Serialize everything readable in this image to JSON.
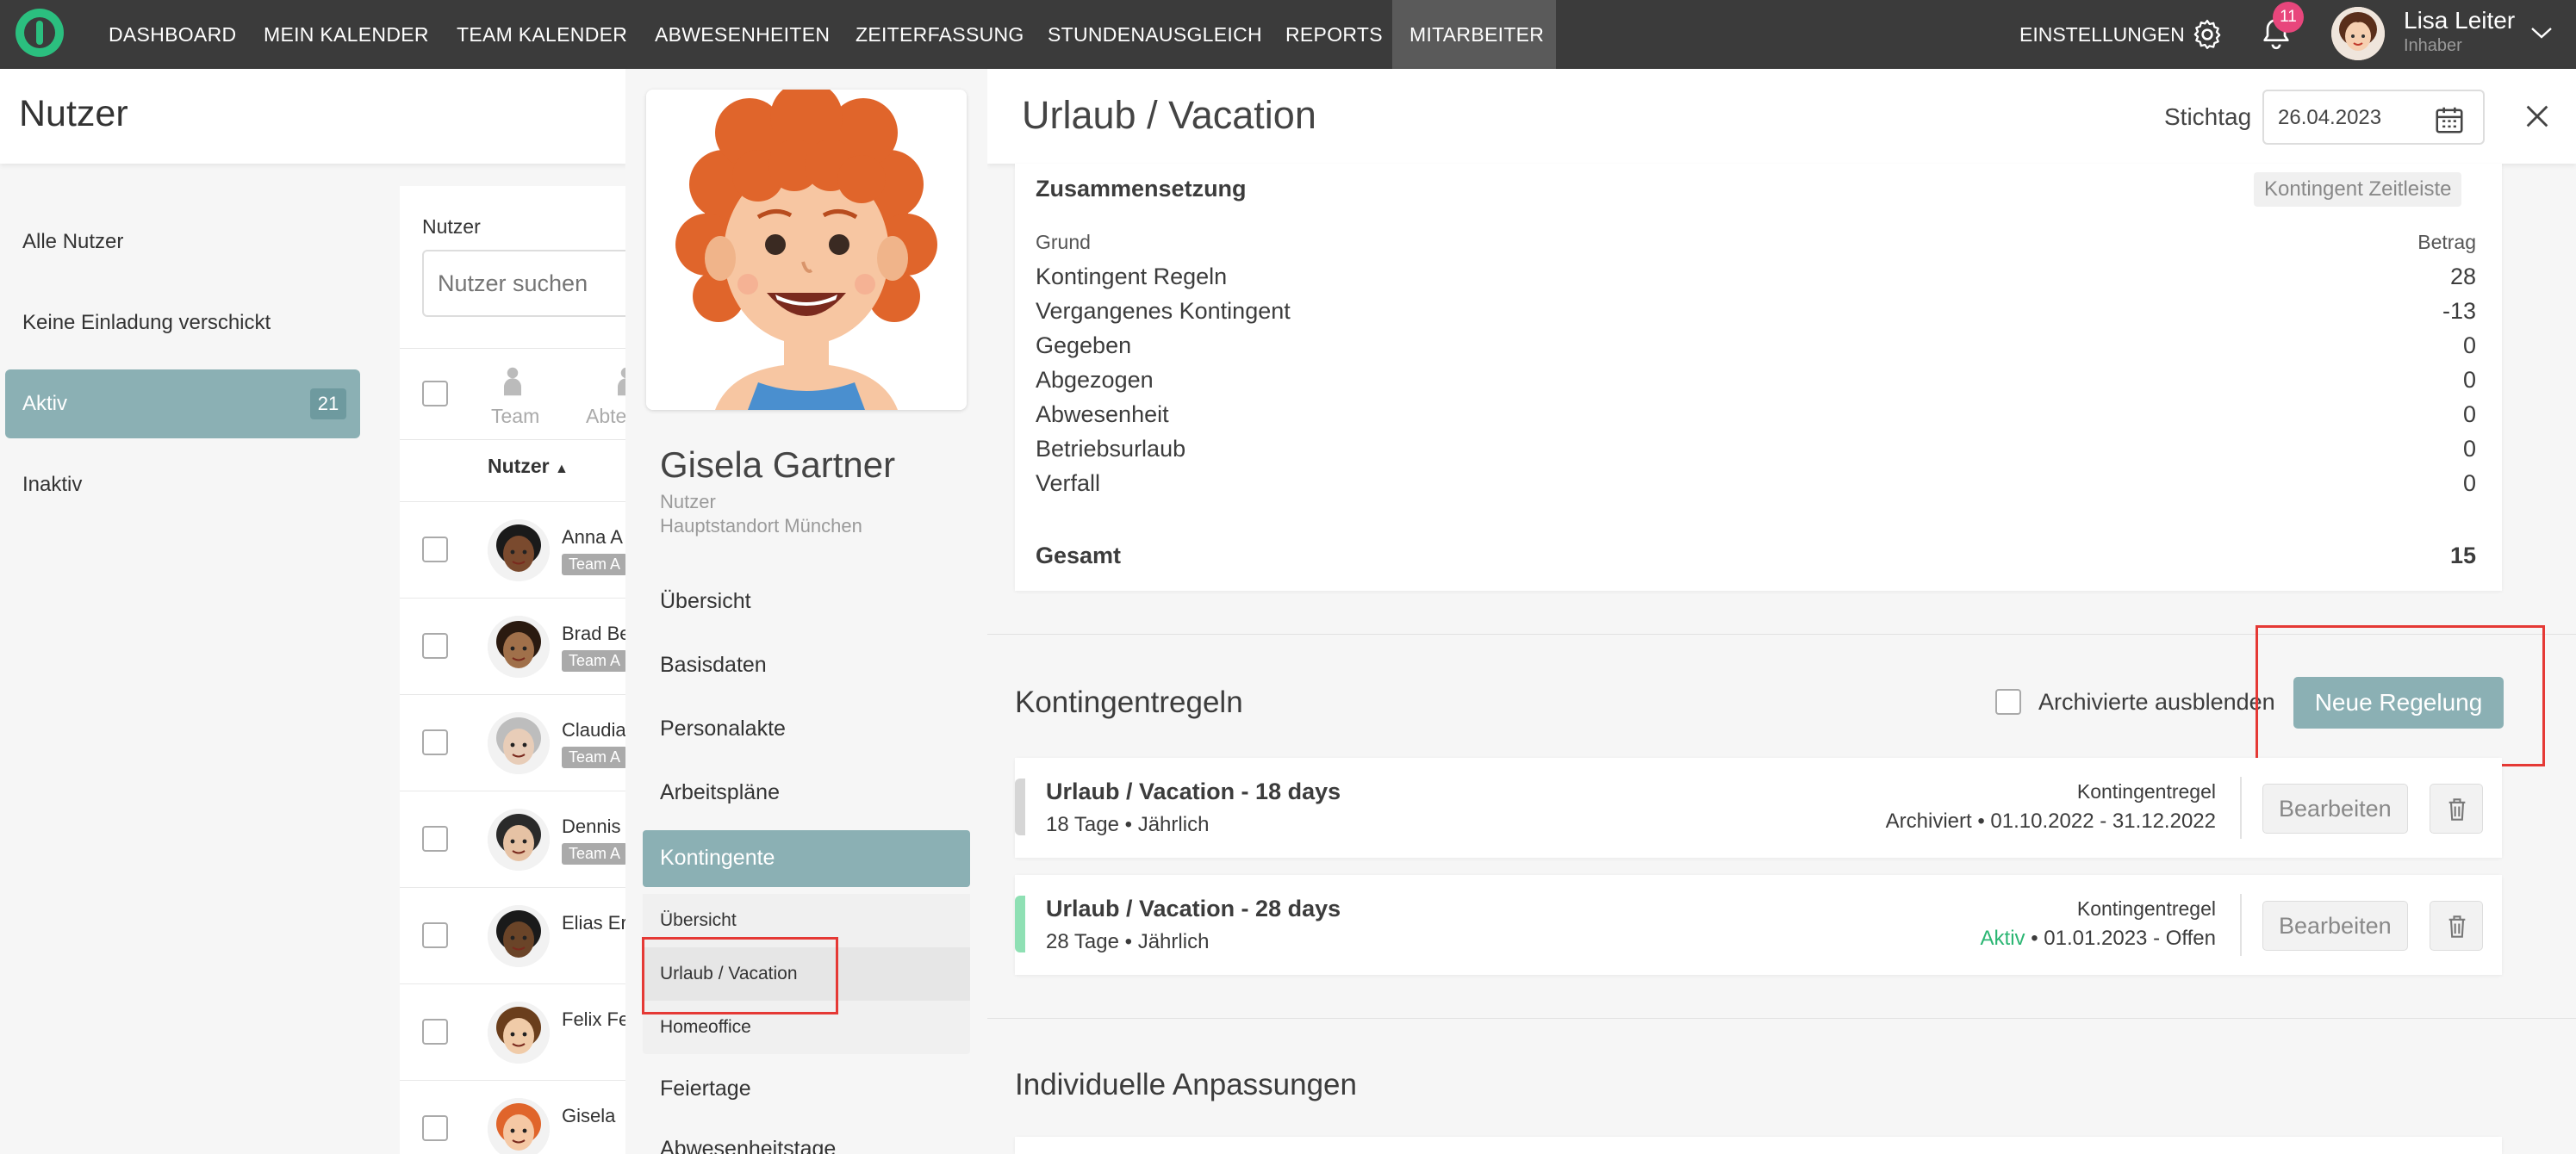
{
  "topbar": {
    "nav": [
      "DASHBOARD",
      "MEIN KALENDER",
      "TEAM KALENDER",
      "ABWESENHEITEN",
      "ZEITERFASSUNG",
      "STUNDENAUSGLEICH",
      "REPORTS",
      "MITARBEITER"
    ],
    "settings_label": "EINSTELLUNGEN",
    "notification_count": "11",
    "user_name": "Lisa Leiter",
    "user_role": "Inhaber"
  },
  "left": {
    "title": "Nutzer",
    "items": [
      {
        "label": "Alle Nutzer"
      },
      {
        "label": "Keine Einladung verschickt"
      },
      {
        "label": "Aktiv",
        "count": "21"
      },
      {
        "label": "Inaktiv"
      }
    ]
  },
  "userlist": {
    "search_label": "Nutzer",
    "search_placeholder": "Nutzer suchen",
    "filter_team": "Team",
    "filter_abt": "Abte",
    "col_header": "Nutzer",
    "users": [
      {
        "name": "Anna A",
        "tag": "Team A"
      },
      {
        "name": "Brad Be",
        "tag": "Team A"
      },
      {
        "name": "Claudia",
        "tag": "Team A"
      },
      {
        "name": "Dennis",
        "tag": "Team A"
      },
      {
        "name": "Elias Er",
        "tag": ""
      },
      {
        "name": "Felix Fe",
        "tag": ""
      },
      {
        "name": "Gisela",
        "tag": ""
      }
    ]
  },
  "profile": {
    "name": "Gisela Gartner",
    "role": "Nutzer",
    "location": "Hauptstandort München",
    "nav": {
      "overview": "Übersicht",
      "basisdaten": "Basisdaten",
      "personalakte": "Personalakte",
      "arbeitsplaene": "Arbeitspläne",
      "kontingente": "Kontingente",
      "sub_overview": "Übersicht",
      "sub_urlaub": "Urlaub / Vacation",
      "sub_homeoffice": "Homeoffice",
      "feiertage": "Feiertage",
      "abwesenheitstage": "Abwesenheitstage"
    }
  },
  "main": {
    "title": "Urlaub / Vacation",
    "stichtag_label": "Stichtag",
    "stichtag_value": "26.04.2023",
    "composition": {
      "title": "Zusammensetzung",
      "timeline_button": "Kontingent Zeitleiste",
      "col_reason": "Grund",
      "col_amount": "Betrag",
      "rows": [
        {
          "label": "Kontingent Regeln",
          "value": "28"
        },
        {
          "label": "Vergangenes Kontingent",
          "value": "-13"
        },
        {
          "label": "Gegeben",
          "value": "0"
        },
        {
          "label": "Abgezogen",
          "value": "0"
        },
        {
          "label": "Abwesenheit",
          "value": "0"
        },
        {
          "label": "Betriebsurlaub",
          "value": "0"
        },
        {
          "label": "Verfall",
          "value": "0"
        }
      ],
      "total_label": "Gesamt",
      "total_value": "15"
    },
    "rules": {
      "title": "Kontingentregeln",
      "hide_archived_label": "Archivierte ausblenden",
      "new_rule_button": "Neue Regelung",
      "items": [
        {
          "name": "Urlaub / Vacation - 18 days",
          "detail": "18 Tage • Jährlich",
          "type": "Kontingentregel",
          "status": "Archiviert",
          "range": " • 01.10.2022 - 31.12.2022",
          "edit": "Bearbeiten"
        },
        {
          "name": "Urlaub / Vacation - 28 days",
          "detail": "28 Tage • Jährlich",
          "type": "Kontingentregel",
          "status": "Aktiv",
          "range": " • 01.01.2023 - Offen",
          "edit": "Bearbeiten"
        }
      ]
    },
    "individual_title": "Individuelle Anpassungen"
  },
  "colors": {
    "accent": "#8bb0b4",
    "active_green": "#2bb673",
    "highlight_red": "#e53935",
    "topbar": "#3b3b3b"
  }
}
